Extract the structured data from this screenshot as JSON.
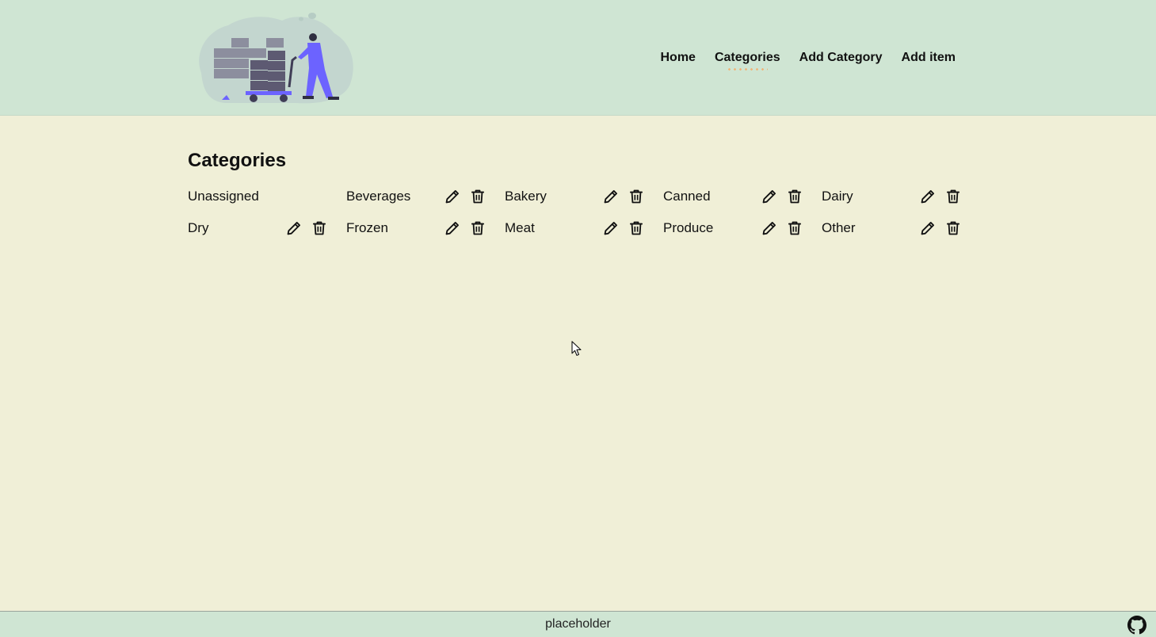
{
  "nav": {
    "items": [
      {
        "label": "Home",
        "active": false
      },
      {
        "label": "Categories",
        "active": true
      },
      {
        "label": "Add Category",
        "active": false
      },
      {
        "label": "Add item",
        "active": false
      }
    ]
  },
  "main": {
    "title": "Categories",
    "categories": [
      {
        "name": "Unassigned",
        "editable": false
      },
      {
        "name": "Beverages",
        "editable": true
      },
      {
        "name": "Bakery",
        "editable": true
      },
      {
        "name": "Canned",
        "editable": true
      },
      {
        "name": "Dairy",
        "editable": true
      },
      {
        "name": "Dry",
        "editable": true
      },
      {
        "name": "Frozen",
        "editable": true
      },
      {
        "name": "Meat",
        "editable": true
      },
      {
        "name": "Produce",
        "editable": true
      },
      {
        "name": "Other",
        "editable": true
      }
    ],
    "action_icons": [
      "pencil-icon",
      "trash-icon"
    ]
  },
  "footer": {
    "text": "placeholder",
    "icon": "github-icon"
  },
  "colors": {
    "header_bg": "#cfe5d3",
    "page_bg": "#f0efd7",
    "accent_dots": "#f0b47a",
    "illustration_purple": "#6c63ff"
  }
}
